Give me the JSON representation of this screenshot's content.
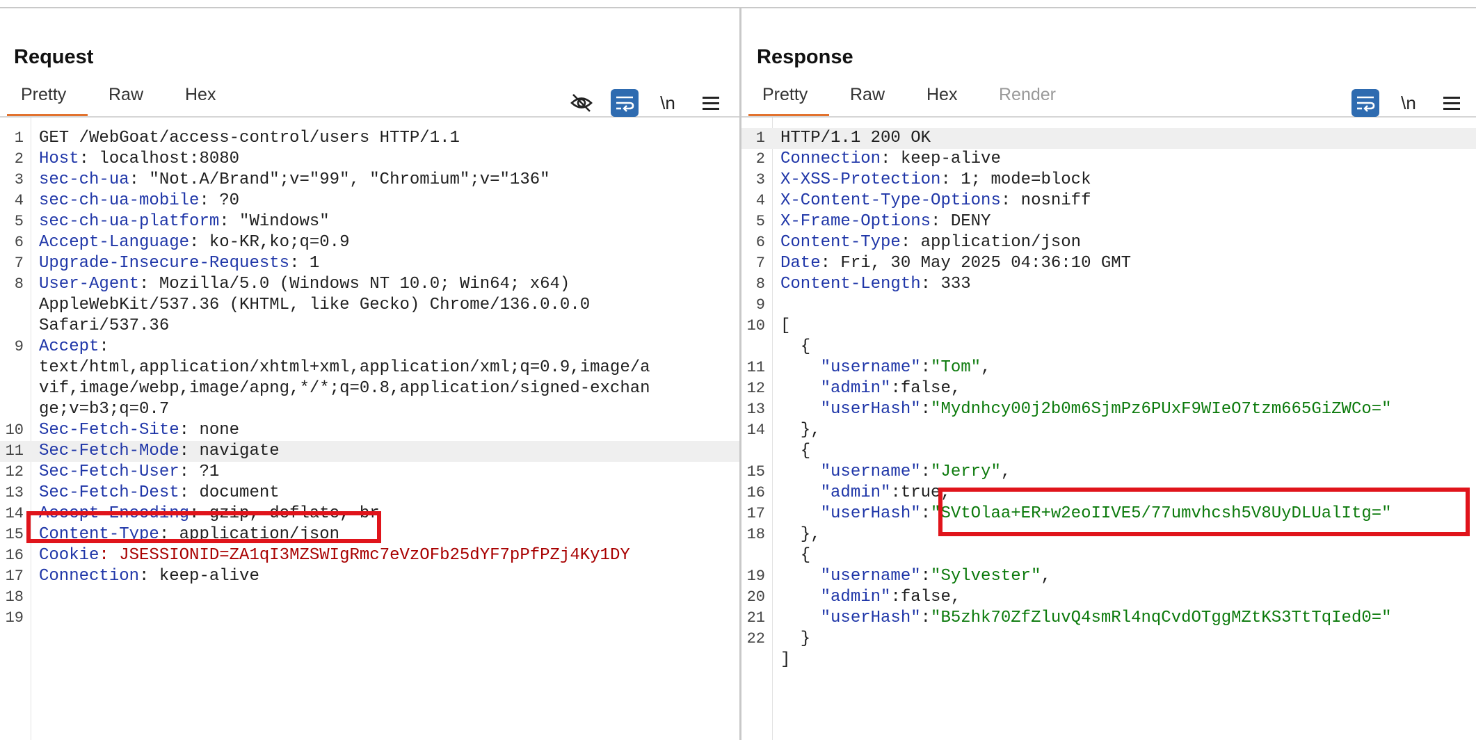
{
  "request": {
    "title": "Request",
    "tabs": [
      "Pretty",
      "Raw",
      "Hex"
    ],
    "active_tab": "Pretty",
    "toolbar": {
      "hide_icon": "eye-off-icon",
      "wrap_icon": "wrap-icon",
      "newline_label": "\\n",
      "menu_icon": "menu-icon"
    },
    "lines": [
      {
        "n": "1",
        "segments": [
          {
            "t": "GET /WebGoat/access-control/users HTTP/1.1",
            "c": "val"
          }
        ]
      },
      {
        "n": "2",
        "segments": [
          {
            "t": "Host",
            "c": "key"
          },
          {
            "t": ": localhost:8080",
            "c": "val"
          }
        ]
      },
      {
        "n": "3",
        "segments": [
          {
            "t": "sec-ch-ua",
            "c": "key"
          },
          {
            "t": ": \"Not.A/Brand\";v=\"99\", \"Chromium\";v=\"136\"",
            "c": "val"
          }
        ]
      },
      {
        "n": "4",
        "segments": [
          {
            "t": "sec-ch-ua-mobile",
            "c": "key"
          },
          {
            "t": ": ?0",
            "c": "val"
          }
        ]
      },
      {
        "n": "5",
        "segments": [
          {
            "t": "sec-ch-ua-platform",
            "c": "key"
          },
          {
            "t": ": \"Windows\"",
            "c": "val"
          }
        ]
      },
      {
        "n": "6",
        "segments": [
          {
            "t": "Accept-Language",
            "c": "key"
          },
          {
            "t": ": ko-KR,ko;q=0.9",
            "c": "val"
          }
        ]
      },
      {
        "n": "7",
        "segments": [
          {
            "t": "Upgrade-Insecure-Requests",
            "c": "key"
          },
          {
            "t": ": 1",
            "c": "val"
          }
        ]
      },
      {
        "n": "8",
        "segments": [
          {
            "t": "User-Agent",
            "c": "key"
          },
          {
            "t": ": Mozilla/5.0 (Windows NT 10.0; Win64; x64)",
            "c": "val"
          }
        ]
      },
      {
        "n": "",
        "segments": [
          {
            "t": "AppleWebKit/537.36 (KHTML, like Gecko) Chrome/136.0.0.0",
            "c": "val"
          }
        ]
      },
      {
        "n": "",
        "segments": [
          {
            "t": "Safari/537.36",
            "c": "val"
          }
        ]
      },
      {
        "n": "9",
        "segments": [
          {
            "t": "Accept",
            "c": "key"
          },
          {
            "t": ":",
            "c": "val"
          }
        ]
      },
      {
        "n": "",
        "segments": [
          {
            "t": "text/html,application/xhtml+xml,application/xml;q=0.9,image/a",
            "c": "val"
          }
        ]
      },
      {
        "n": "",
        "segments": [
          {
            "t": "vif,image/webp,image/apng,*/*;q=0.8,application/signed-exchan",
            "c": "val"
          }
        ]
      },
      {
        "n": "",
        "segments": [
          {
            "t": "ge;v=b3;q=0.7",
            "c": "val"
          }
        ]
      },
      {
        "n": "10",
        "segments": [
          {
            "t": "Sec-Fetch-Site",
            "c": "key"
          },
          {
            "t": ": none",
            "c": "val"
          }
        ]
      },
      {
        "n": "11",
        "segments": [
          {
            "t": "Sec-Fetch-Mode",
            "c": "key"
          },
          {
            "t": ": navigate",
            "c": "val"
          }
        ],
        "highlight": true
      },
      {
        "n": "12",
        "segments": [
          {
            "t": "Sec-Fetch-User",
            "c": "key"
          },
          {
            "t": ": ?1",
            "c": "val"
          }
        ]
      },
      {
        "n": "13",
        "segments": [
          {
            "t": "Sec-Fetch-Dest",
            "c": "key"
          },
          {
            "t": ": document",
            "c": "val"
          }
        ]
      },
      {
        "n": "14",
        "segments": [
          {
            "t": "Accept-Encoding",
            "c": "key"
          },
          {
            "t": ": gzip, deflate, br",
            "c": "val"
          }
        ]
      },
      {
        "n": "15",
        "segments": [
          {
            "t": "Content-Type",
            "c": "key"
          },
          {
            "t": ": application/json",
            "c": "val"
          }
        ]
      },
      {
        "n": "16",
        "segments": [
          {
            "t": "Cookie",
            "c": "key"
          },
          {
            "t": ": JSESSIONID=ZA1qI3MZSWIgRmc7eVzOFb25dYF7pPfPZj4Ky1DY",
            "c": "red"
          }
        ]
      },
      {
        "n": "17",
        "segments": [
          {
            "t": "Connection",
            "c": "key"
          },
          {
            "t": ": keep-alive",
            "c": "val"
          }
        ]
      },
      {
        "n": "18",
        "segments": []
      },
      {
        "n": "19",
        "segments": []
      }
    ]
  },
  "response": {
    "title": "Response",
    "tabs": [
      "Pretty",
      "Raw",
      "Hex",
      "Render"
    ],
    "active_tab": "Pretty",
    "toolbar": {
      "wrap_icon": "wrap-icon",
      "newline_label": "\\n",
      "menu_icon": "menu-icon"
    },
    "lines": [
      {
        "n": "1",
        "segments": [
          {
            "t": "HTTP/1.1 200 OK",
            "c": "val"
          }
        ],
        "highlight": true
      },
      {
        "n": "2",
        "segments": [
          {
            "t": "Connection",
            "c": "key"
          },
          {
            "t": ": keep-alive",
            "c": "val"
          }
        ]
      },
      {
        "n": "3",
        "segments": [
          {
            "t": "X-XSS-Protection",
            "c": "key"
          },
          {
            "t": ": 1; mode=block",
            "c": "val"
          }
        ]
      },
      {
        "n": "4",
        "segments": [
          {
            "t": "X-Content-Type-Options",
            "c": "key"
          },
          {
            "t": ": nosniff",
            "c": "val"
          }
        ]
      },
      {
        "n": "5",
        "segments": [
          {
            "t": "X-Frame-Options",
            "c": "key"
          },
          {
            "t": ": DENY",
            "c": "val"
          }
        ]
      },
      {
        "n": "6",
        "segments": [
          {
            "t": "Content-Type",
            "c": "key"
          },
          {
            "t": ": application/json",
            "c": "val"
          }
        ]
      },
      {
        "n": "7",
        "segments": [
          {
            "t": "Date",
            "c": "key"
          },
          {
            "t": ": Fri, 30 May 2025 04:36:10 GMT",
            "c": "val"
          }
        ]
      },
      {
        "n": "8",
        "segments": [
          {
            "t": "Content-Length",
            "c": "key"
          },
          {
            "t": ": 333",
            "c": "val"
          }
        ]
      },
      {
        "n": "9",
        "segments": []
      },
      {
        "n": "10",
        "segments": [
          {
            "t": "[",
            "c": "val"
          }
        ]
      },
      {
        "n": "",
        "segments": [
          {
            "t": "  {",
            "c": "val"
          }
        ]
      },
      {
        "n": "11",
        "segments": [
          {
            "t": "    ",
            "c": "val"
          },
          {
            "t": "\"username\"",
            "c": "jkey"
          },
          {
            "t": ":",
            "c": "val"
          },
          {
            "t": "\"Tom\"",
            "c": "jstr"
          },
          {
            "t": ",",
            "c": "val"
          }
        ]
      },
      {
        "n": "12",
        "segments": [
          {
            "t": "    ",
            "c": "val"
          },
          {
            "t": "\"admin\"",
            "c": "jkey"
          },
          {
            "t": ":false,",
            "c": "val"
          }
        ]
      },
      {
        "n": "13",
        "segments": [
          {
            "t": "    ",
            "c": "val"
          },
          {
            "t": "\"userHash\"",
            "c": "jkey"
          },
          {
            "t": ":",
            "c": "val"
          },
          {
            "t": "\"Mydnhcy00j2b0m6SjmPz6PUxF9WIeO7tzm665GiZWCo=\"",
            "c": "jstr"
          }
        ]
      },
      {
        "n": "14",
        "segments": [
          {
            "t": "  },",
            "c": "val"
          }
        ]
      },
      {
        "n": "",
        "segments": [
          {
            "t": "  {",
            "c": "val"
          }
        ]
      },
      {
        "n": "15",
        "segments": [
          {
            "t": "    ",
            "c": "val"
          },
          {
            "t": "\"username\"",
            "c": "jkey"
          },
          {
            "t": ":",
            "c": "val"
          },
          {
            "t": "\"Jerry\"",
            "c": "jstr"
          },
          {
            "t": ",",
            "c": "val"
          }
        ]
      },
      {
        "n": "16",
        "segments": [
          {
            "t": "    ",
            "c": "val"
          },
          {
            "t": "\"admin\"",
            "c": "jkey"
          },
          {
            "t": ":true,",
            "c": "val"
          }
        ]
      },
      {
        "n": "17",
        "segments": [
          {
            "t": "    ",
            "c": "val"
          },
          {
            "t": "\"userHash\"",
            "c": "jkey"
          },
          {
            "t": ":",
            "c": "val"
          },
          {
            "t": "\"SVtOlaa+ER+w2eoIIVE5/77umvhcsh5V8UyDLUalItg=\"",
            "c": "jstr"
          }
        ]
      },
      {
        "n": "18",
        "segments": [
          {
            "t": "  },",
            "c": "val"
          }
        ]
      },
      {
        "n": "",
        "segments": [
          {
            "t": "  {",
            "c": "val"
          }
        ]
      },
      {
        "n": "19",
        "segments": [
          {
            "t": "    ",
            "c": "val"
          },
          {
            "t": "\"username\"",
            "c": "jkey"
          },
          {
            "t": ":",
            "c": "val"
          },
          {
            "t": "\"Sylvester\"",
            "c": "jstr"
          },
          {
            "t": ",",
            "c": "val"
          }
        ]
      },
      {
        "n": "20",
        "segments": [
          {
            "t": "    ",
            "c": "val"
          },
          {
            "t": "\"admin\"",
            "c": "jkey"
          },
          {
            "t": ":false,",
            "c": "val"
          }
        ]
      },
      {
        "n": "21",
        "segments": [
          {
            "t": "    ",
            "c": "val"
          },
          {
            "t": "\"userHash\"",
            "c": "jkey"
          },
          {
            "t": ":",
            "c": "val"
          },
          {
            "t": "\"B5zhk70ZfZluvQ4smRl4nqCvdOTggMZtKS3TtTqIed0=\"",
            "c": "jstr"
          }
        ]
      },
      {
        "n": "22",
        "segments": [
          {
            "t": "  }",
            "c": "val"
          }
        ]
      },
      {
        "n": "",
        "segments": [
          {
            "t": "]",
            "c": "val"
          }
        ]
      }
    ]
  },
  "view_switcher": {
    "options": [
      "split-vertical-icon",
      "split-horizontal-icon",
      "single-pane-icon"
    ],
    "active": 0
  },
  "colors": {
    "accent": "#e2722e",
    "toolbar_blue": "#2e6bb0",
    "header_key": "#1f36a8",
    "json_string": "#0c7a0c",
    "cookie": "#a80000",
    "annotation": "#e0141b"
  }
}
